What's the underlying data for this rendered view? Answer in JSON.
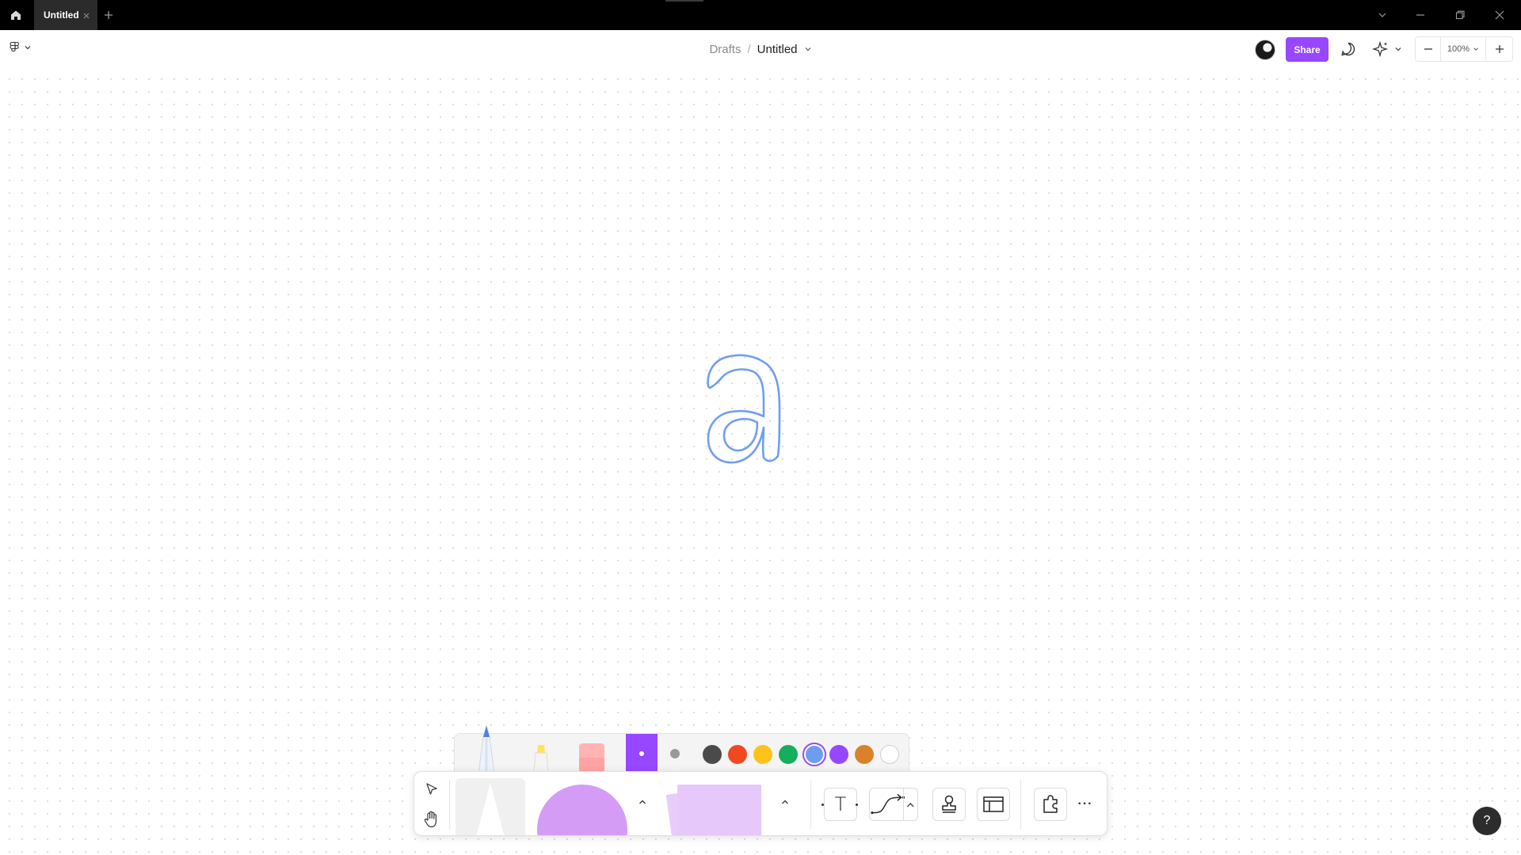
{
  "titlebar": {
    "tab_title": "Untitled",
    "icons": [
      "home-icon",
      "close-icon",
      "plus-icon",
      "chevron-down-icon",
      "minimize-icon",
      "restore-icon",
      "close-window-icon"
    ]
  },
  "header": {
    "breadcrumb_parent": "Drafts",
    "breadcrumb_sep": "/",
    "file_title": "Untitled",
    "share_label": "Share",
    "zoom_value": "100%",
    "accent_color": "#9747ff"
  },
  "canvas": {
    "drawing_stroke_color": "#6f9ef0",
    "drawing_char": "a"
  },
  "pen_tray": {
    "selected_stroke": "thin",
    "colors": [
      {
        "name": "black",
        "hex": "#4a4a4a"
      },
      {
        "name": "red",
        "hex": "#f24822"
      },
      {
        "name": "yellow",
        "hex": "#ffc21a"
      },
      {
        "name": "green",
        "hex": "#14ae5c"
      },
      {
        "name": "blue",
        "hex": "#6e9cf0",
        "selected": true
      },
      {
        "name": "violet",
        "hex": "#9747ff"
      },
      {
        "name": "orange",
        "hex": "#d9822b"
      },
      {
        "name": "white",
        "hex": "#ffffff"
      }
    ]
  },
  "toolbar": {
    "more_label": "···",
    "text_tool_glyph": "T"
  },
  "help": {
    "label": "?"
  }
}
